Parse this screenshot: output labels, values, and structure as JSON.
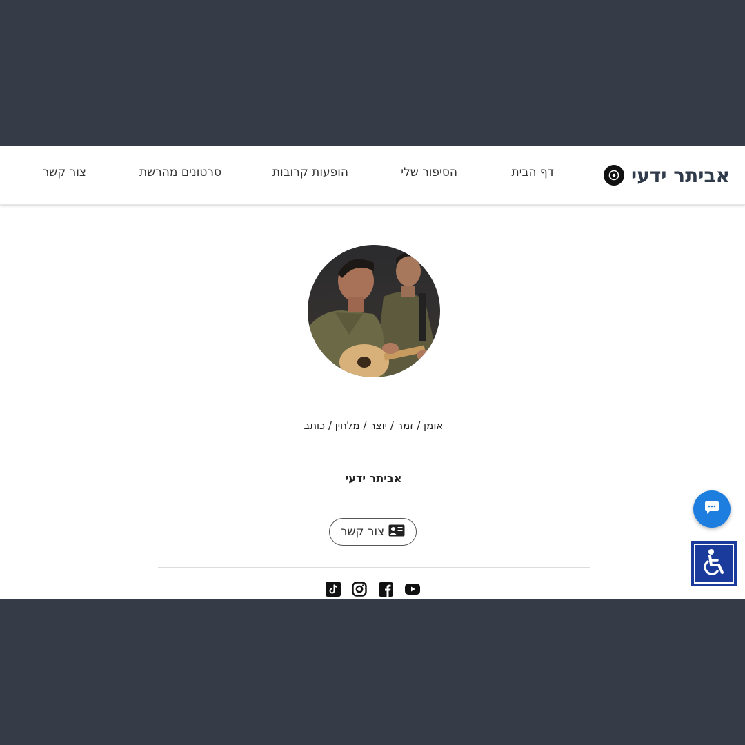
{
  "header": {
    "brand_name": "אביתר ידעי",
    "brand_icon": "vinyl-record-icon",
    "nav": [
      {
        "label": "דף הבית"
      },
      {
        "label": "הסיפור שלי"
      },
      {
        "label": "הופעות קרובות"
      },
      {
        "label": "סרטונים מהרשת"
      },
      {
        "label": "צור קשר"
      }
    ]
  },
  "profile": {
    "tagline": "אומן / זמר / יוצר / מלחין / כותב",
    "artist_name": "אביתר ידעי",
    "contact_button": {
      "label": "צור קשר",
      "icon": "contact-card-icon"
    }
  },
  "socials": [
    {
      "icon": "youtube-icon"
    },
    {
      "icon": "facebook-icon"
    },
    {
      "icon": "instagram-icon"
    },
    {
      "icon": "tiktok-icon"
    }
  ],
  "widgets": {
    "chat_icon": "chat-bubble-icon",
    "accessibility_icon": "wheelchair-icon"
  },
  "colors": {
    "backdrop": "#363c47",
    "chat_button": "#1e7ee0",
    "accessibility_button": "#1a3a9c",
    "brand_text": "#2f3a4a"
  }
}
